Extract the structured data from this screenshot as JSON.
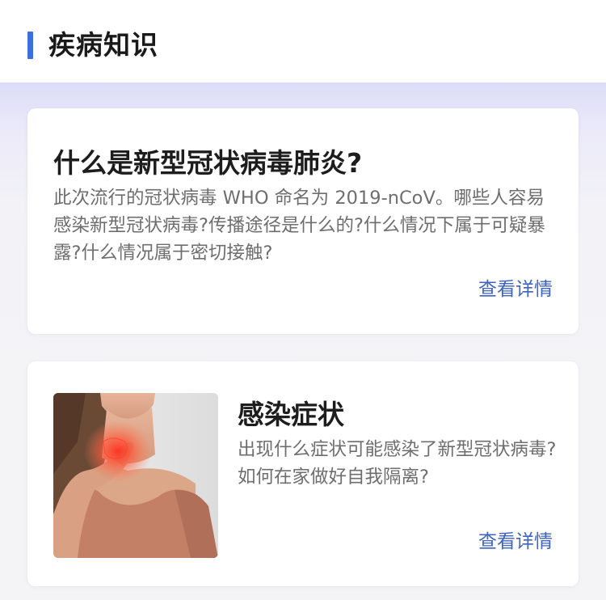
{
  "header": {
    "title": "疾病知识",
    "accent_color": "#3b6fe0"
  },
  "cards": [
    {
      "title": "什么是新型冠状病毒肺炎?",
      "description": "此次流行的冠状病毒 WHO 命名为 2019-nCoV。哪些人容易感染新型冠状病毒?传播途径是什么的?什么情况下属于可疑暴露?什么情况属于密切接触?",
      "link_label": "查看详情"
    },
    {
      "title": "感染症状",
      "description": "出现什么症状可能感染了新型冠状病毒?如何在家做好自我隔离?",
      "link_label": "查看详情",
      "image": "woman-holding-sore-throat-photo"
    }
  ],
  "colors": {
    "link": "#3d64bf",
    "card_background": "#ffffff",
    "page_background": "#f1f2f6"
  }
}
